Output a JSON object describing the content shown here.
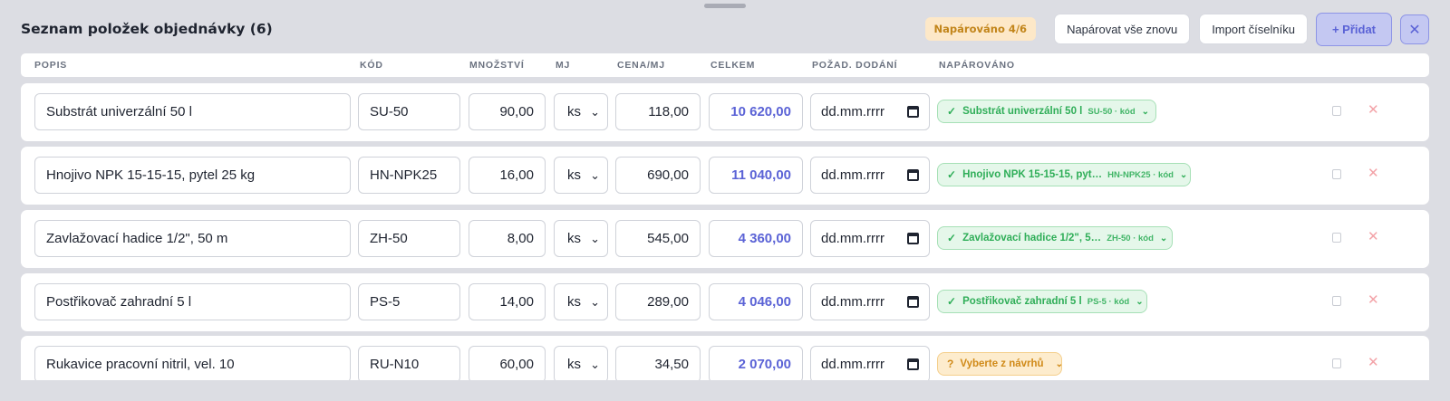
{
  "header": {
    "title": "Seznam položek objednávky (6)",
    "status": "Napárováno 4/6",
    "rematch_label": "Napárovat vše znovu",
    "import_label": "Import číselníku",
    "add_label": "+ Přidat",
    "close_icon": "close-icon"
  },
  "columns": [
    "POPIS",
    "KÓD",
    "MNOŽSTVÍ",
    "MJ",
    "CENA/MJ",
    "CELKEM",
    "POŽAD. DODÁNÍ",
    "NAPÁROVÁNO"
  ],
  "rows": [
    {
      "popis": "Substrát univerzální 50 l",
      "kod": "SU-50",
      "mnozstvi": "90,00",
      "mj": "ks",
      "cena": "118,00",
      "celkem": "10 620,00",
      "datum": "dd.mm.rrrr",
      "match_status": "ok",
      "match_icon": "✓",
      "match_name": "Substrát univerzální 50 l",
      "match_code": "SU-50 · kód"
    },
    {
      "popis": "Hnojivo NPK 15-15-15, pytel 25 kg",
      "kod": "HN-NPK25",
      "mnozstvi": "16,00",
      "mj": "ks",
      "cena": "690,00",
      "celkem": "11 040,00",
      "datum": "dd.mm.rrrr",
      "match_status": "ok",
      "match_icon": "✓",
      "match_name": "Hnojivo NPK 15-15-15, pyt…",
      "match_code": "HN-NPK25 · kód"
    },
    {
      "popis": "Zavlažovací hadice 1/2\", 50 m",
      "kod": "ZH-50",
      "mnozstvi": "8,00",
      "mj": "ks",
      "cena": "545,00",
      "celkem": "4 360,00",
      "datum": "dd.mm.rrrr",
      "match_status": "ok",
      "match_icon": "✓",
      "match_name": "Zavlažovací hadice 1/2\", 5…",
      "match_code": "ZH-50 · kód"
    },
    {
      "popis": "Postřikovač zahradní 5 l",
      "kod": "PS-5",
      "mnozstvi": "14,00",
      "mj": "ks",
      "cena": "289,00",
      "celkem": "4 046,00",
      "datum": "dd.mm.rrrr",
      "match_status": "ok",
      "match_icon": "✓",
      "match_name": "Postřikovač zahradní 5 l",
      "match_code": "PS-5 · kód"
    },
    {
      "popis": "Rukavice pracovní nitril, vel. 10",
      "kod": "RU-N10",
      "mnozstvi": "60,00",
      "mj": "ks",
      "cena": "34,50",
      "celkem": "2 070,00",
      "datum": "dd.mm.rrrr",
      "match_status": "warn",
      "match_icon": "?",
      "match_name": "Vyberte z návrhů",
      "match_code": ""
    }
  ],
  "colors": {
    "accent": "#5b63d6",
    "ok": "#2fae58",
    "warn": "#d08a18",
    "delete": "#f3a3a8"
  }
}
